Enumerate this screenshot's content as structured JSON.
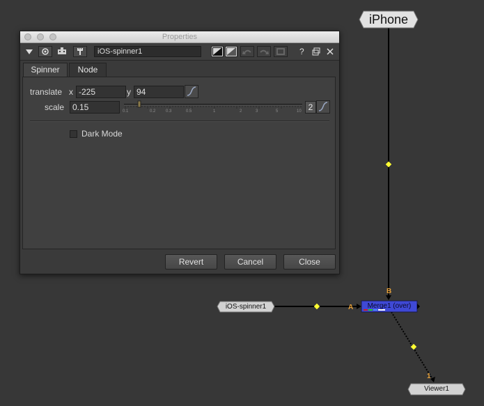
{
  "window": {
    "title": "Properties"
  },
  "toolbar": {
    "node_name": "iOS-spinner1",
    "help_label": "?"
  },
  "tabs": [
    {
      "label": "Spinner"
    },
    {
      "label": "Node"
    }
  ],
  "knobs": {
    "translate": {
      "label": "translate",
      "x_label": "x",
      "x_value": "-225",
      "y_label": "y",
      "y_value": "94"
    },
    "scale": {
      "label": "scale",
      "value": "0.15",
      "steps": "2",
      "slider_ticks": [
        "0.1",
        "0.2",
        "0.3",
        "0.5",
        "1",
        "2",
        "3",
        "5",
        "10"
      ]
    },
    "dark_mode": {
      "label": "Dark Mode",
      "checked": false
    }
  },
  "buttons": {
    "revert": "Revert",
    "cancel": "Cancel",
    "close": "Close"
  },
  "graph": {
    "nodes": {
      "iphone": "iPhone",
      "spinner": "iOS-spinner1",
      "merge": "Merge1 (over)",
      "viewer": "Viewer1"
    },
    "inputs": {
      "b": "B",
      "a": "A",
      "viewer_input": "1"
    }
  },
  "colors": {
    "graph_bg": "#373737",
    "merge_node": "#3f49d6",
    "input_label": "#e8a23a",
    "dot": "#ffff33"
  },
  "icons": [
    "triangle-down-icon",
    "circle-dot-icon",
    "robot-icon",
    "wrench-icon",
    "color-swatch-icon",
    "undo-icon",
    "redo-icon",
    "reset-icon",
    "help-icon",
    "float-icon",
    "close-icon",
    "curve-icon"
  ]
}
